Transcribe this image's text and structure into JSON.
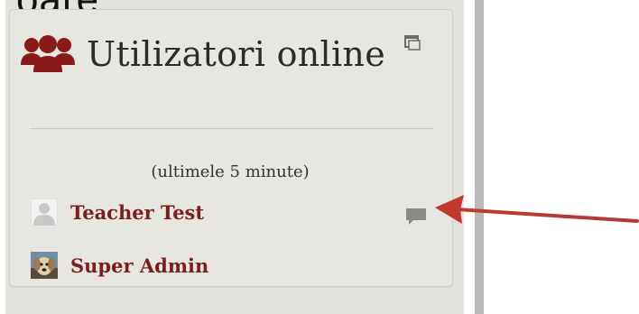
{
  "page": {
    "top_fragment": "oare"
  },
  "block": {
    "title": "Utilizatori online",
    "icon": "users-icon",
    "dock_icon": "dock-icon",
    "period_label": "(ultimele 5 minute)",
    "users": [
      {
        "name": "Teacher Test",
        "avatar": "default-user-avatar",
        "message_icon": "chat-bubble-icon"
      },
      {
        "name": "Super Admin",
        "avatar": "dog-photo-avatar"
      }
    ]
  },
  "colors": {
    "block_bg": "#e8e6e1",
    "user_link": "#7b1e1e",
    "users_icon": "#8b1a1a",
    "arrow": "#c0392b",
    "scrollbar": "#b9b9b9"
  }
}
